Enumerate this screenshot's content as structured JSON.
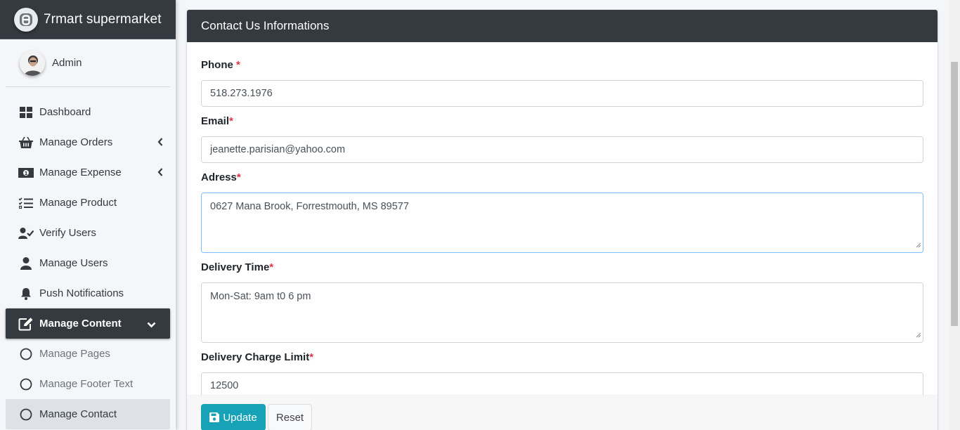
{
  "brand": {
    "name": "7rmart supermarket",
    "icon": "logo-icon"
  },
  "user": {
    "name": "Admin",
    "icon": "user-avatar"
  },
  "sidebar": {
    "items": [
      {
        "label": "Dashboard",
        "icon": "dashboard-icon"
      },
      {
        "label": "Manage Orders",
        "icon": "basket-icon"
      },
      {
        "label": "Manage Expense",
        "icon": "money-icon"
      },
      {
        "label": "Manage Product",
        "icon": "tasks-icon"
      },
      {
        "label": "Verify Users",
        "icon": "user-check-icon"
      },
      {
        "label": "Manage Users",
        "icon": "user-icon"
      },
      {
        "label": "Push Notifications",
        "icon": "bell-icon"
      },
      {
        "label": "Manage Content",
        "icon": "edit-icon"
      },
      {
        "label": "Manage Pages",
        "icon": "circle-icon"
      },
      {
        "label": "Manage Footer Text",
        "icon": "circle-icon"
      },
      {
        "label": "Manage Contact",
        "icon": "circle-icon"
      }
    ]
  },
  "card": {
    "title": "Contact Us Informations"
  },
  "form": {
    "phone_label": "Phone",
    "phone_value": "518.273.1976",
    "email_label": "Email",
    "email_value": "jeanette.parisian@yahoo.com",
    "address_label": "Adress",
    "address_value": "0627 Mana Brook, Forrestmouth, MS 89577",
    "delivery_time_label": "Delivery Time",
    "delivery_time_value": "Mon-Sat: 9am t0 6 pm",
    "delivery_charge_label": "Delivery Charge Limit",
    "delivery_charge_value": "12500",
    "required_marker": "*"
  },
  "buttons": {
    "update": "Update",
    "reset": "Reset"
  },
  "colors": {
    "dark": "#343a40",
    "accent": "#17a2b8",
    "required": "#dc3545"
  }
}
